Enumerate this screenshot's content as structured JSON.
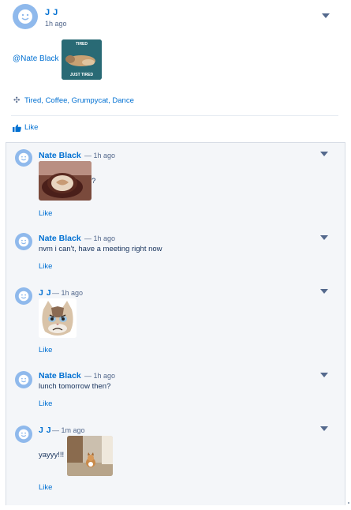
{
  "post": {
    "author": "J J",
    "time": "1h ago",
    "mention": "@Nate Black",
    "image": {
      "top_caption": "TIRED",
      "bottom_caption": "JUST TIRED"
    },
    "topics": "Tired, Coffee, Grumpycat, Dance",
    "like_label": "Like"
  },
  "comments": [
    {
      "author": "Nate Black",
      "sep": "— 1h ago",
      "text": "?",
      "like": "Like"
    },
    {
      "author": "Nate Black",
      "sep": "— 1h ago",
      "text": "nvm i can't, have a meeting right now",
      "like": "Like"
    },
    {
      "author": "J J",
      "sep": "— 1h ago",
      "text": "",
      "like": "Like"
    },
    {
      "author": "Nate Black",
      "sep": "— 1h ago",
      "text": "lunch tomorrow then?",
      "like": "Like"
    },
    {
      "author": "J J",
      "sep": "— 1m ago",
      "text": "yayyy!!!",
      "like": "Like"
    }
  ],
  "icons": {
    "avatar": "user-avatar-icon",
    "menu": "chevron-down-icon",
    "topics": "topics-icon",
    "like": "thumbs-up-icon"
  },
  "colors": {
    "link": "#0070d2",
    "avatar": "#8fb9ec",
    "panel": "#f4f6f9"
  }
}
